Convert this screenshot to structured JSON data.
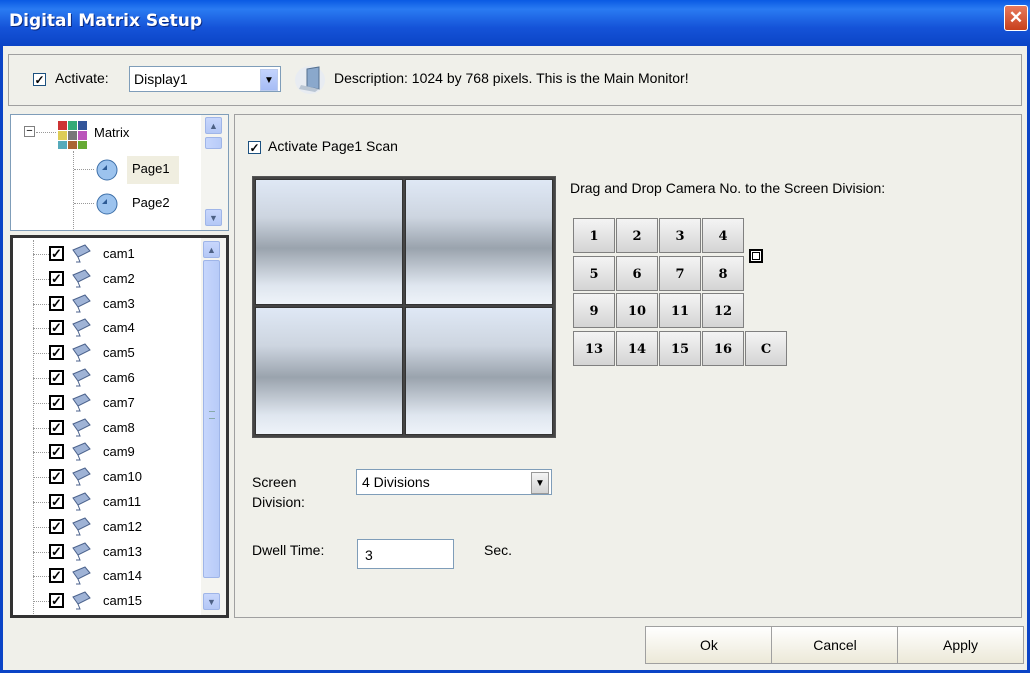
{
  "window": {
    "title": "Digital Matrix Setup",
    "close_glyph": "✕"
  },
  "toolbar": {
    "activate_label": "Activate:",
    "activate_checked": "✓",
    "display_value": "Display1",
    "description": "Description: 1024 by 768 pixels. This is the Main Monitor!"
  },
  "tree": {
    "root_label": "Matrix",
    "pages": [
      "Page1",
      "Page2"
    ]
  },
  "cameras": [
    "cam1",
    "cam2",
    "cam3",
    "cam4",
    "cam5",
    "cam6",
    "cam7",
    "cam8",
    "cam9",
    "cam10",
    "cam11",
    "cam12",
    "cam13",
    "cam14",
    "cam15"
  ],
  "page_panel": {
    "scan_label": "Activate Page1 Scan",
    "drag_hint": "Drag and Drop Camera No. to the Screen Division:",
    "numbers": [
      "1",
      "2",
      "3",
      "4",
      "5",
      "6",
      "7",
      "8",
      "9",
      "10",
      "11",
      "12",
      "13",
      "14",
      "15",
      "16"
    ],
    "clear_label": "C",
    "screen_division_label_1": "Screen",
    "screen_division_label_2": "Division:",
    "screen_division_value": "4 Divisions",
    "dwell_label": "Dwell Time:",
    "dwell_value": "3",
    "dwell_unit": "Sec."
  },
  "buttons": {
    "ok": "Ok",
    "cancel": "Cancel",
    "apply": "Apply"
  }
}
